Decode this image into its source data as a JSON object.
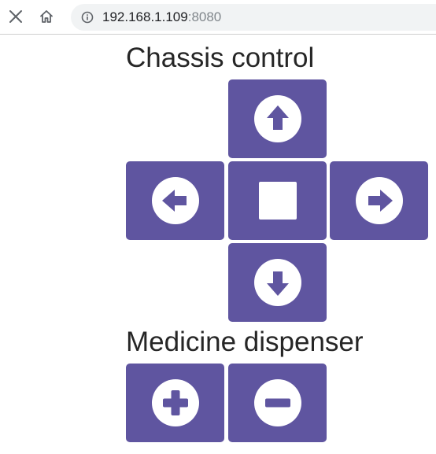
{
  "browser": {
    "close_icon": "close-icon",
    "home_icon": "home-icon",
    "info_icon": "info-circle-icon",
    "url_host": "192.168.1.109",
    "url_port": ":8080"
  },
  "chassis": {
    "title": "Chassis control",
    "buttons": {
      "up": "arrow-up-circle-icon",
      "left": "arrow-left-circle-icon",
      "stop": "stop-square-icon",
      "right": "arrow-right-circle-icon",
      "down": "arrow-down-circle-icon"
    }
  },
  "dispenser": {
    "title": "Medicine dispenser",
    "buttons": {
      "plus": "plus-circle-icon",
      "minus": "minus-circle-icon"
    }
  },
  "colors": {
    "button_bg": "#5f55a0",
    "icon_fg": "#ffffff",
    "title_text": "#262626"
  }
}
